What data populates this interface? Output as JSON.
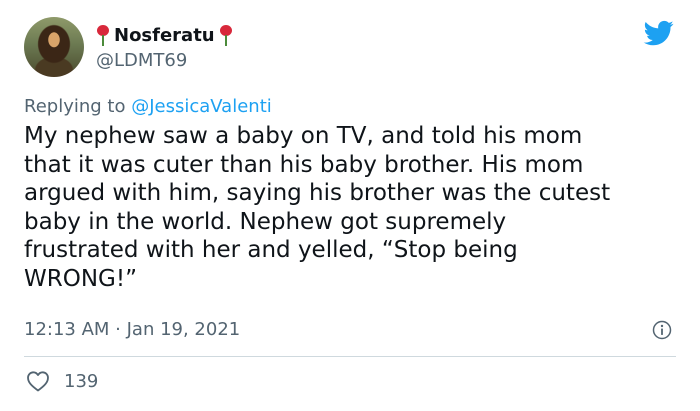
{
  "author": {
    "display_name": "Nosferatu",
    "handle": "@LDMT69"
  },
  "reply": {
    "prefix": "Replying to ",
    "mention": "@JessicaValenti"
  },
  "tweet": {
    "text": "My nephew saw a baby on TV, and told his mom\nthat it was cuter than his baby brother. His mom\nargued with him, saying his brother was the cutest\nbaby in the world. Nephew got supremely\nfrustrated with her and yelled, “Stop being\nWRONG!”",
    "timestamp": "12:13 AM · Jan 19, 2021",
    "likes": "139"
  },
  "icons": {
    "brand": "twitter-bird-icon",
    "info": "info-icon",
    "like": "heart-icon",
    "decoration": "rose-icon"
  },
  "colors": {
    "accent": "#1da1f2",
    "text": "#0f1419",
    "muted": "#536471",
    "rose": "#d8283b"
  }
}
